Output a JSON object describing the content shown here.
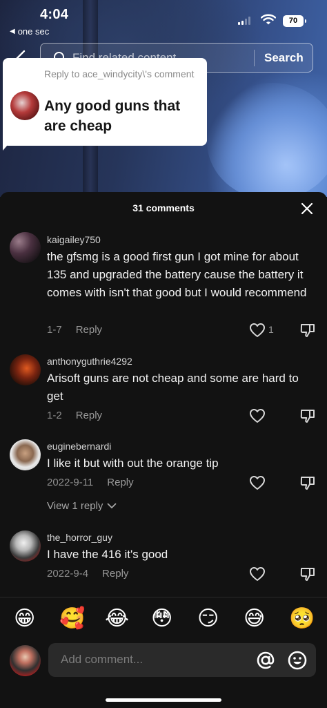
{
  "status_bar": {
    "time": "4:04",
    "back_app": "one sec",
    "battery": "70"
  },
  "search": {
    "placeholder": "Find related content",
    "button_label": "Search"
  },
  "reply_sticker": {
    "label": "Reply to ace_windycity\\'s comment",
    "text": "Any good guns that are cheap"
  },
  "sheet": {
    "title": "31 comments"
  },
  "comments": [
    {
      "user": "kaigailey750",
      "text": "the gfsmg is a good first gun I got mine for about 135 and upgraded the battery cause the battery it comes with isn't that good but I would recommend",
      "date": "1-7",
      "reply_label": "Reply",
      "likes": "1"
    },
    {
      "user": "anthonyguthrie4292",
      "text": "Arisoft guns are not cheap and some are hard to get",
      "date": "1-2",
      "reply_label": "Reply"
    },
    {
      "user": "euginebernardi",
      "text": "I like it but with out the orange tip",
      "date": "2022-9-11",
      "reply_label": "Reply",
      "view_replies": "View 1 reply"
    },
    {
      "user": "the_horror_guy",
      "text": "I have the 416 it's good",
      "date": "2022-9-4",
      "reply_label": "Reply"
    }
  ],
  "emoji_bar": [
    "😁",
    "🥰",
    "😂",
    "😳",
    "😏",
    "😅",
    "🥺"
  ],
  "composer": {
    "placeholder": "Add comment..."
  },
  "colors": {
    "sheet_bg": "#121212",
    "input_bg": "#2a2a2a",
    "secondary_text": "#8e8e8e"
  }
}
